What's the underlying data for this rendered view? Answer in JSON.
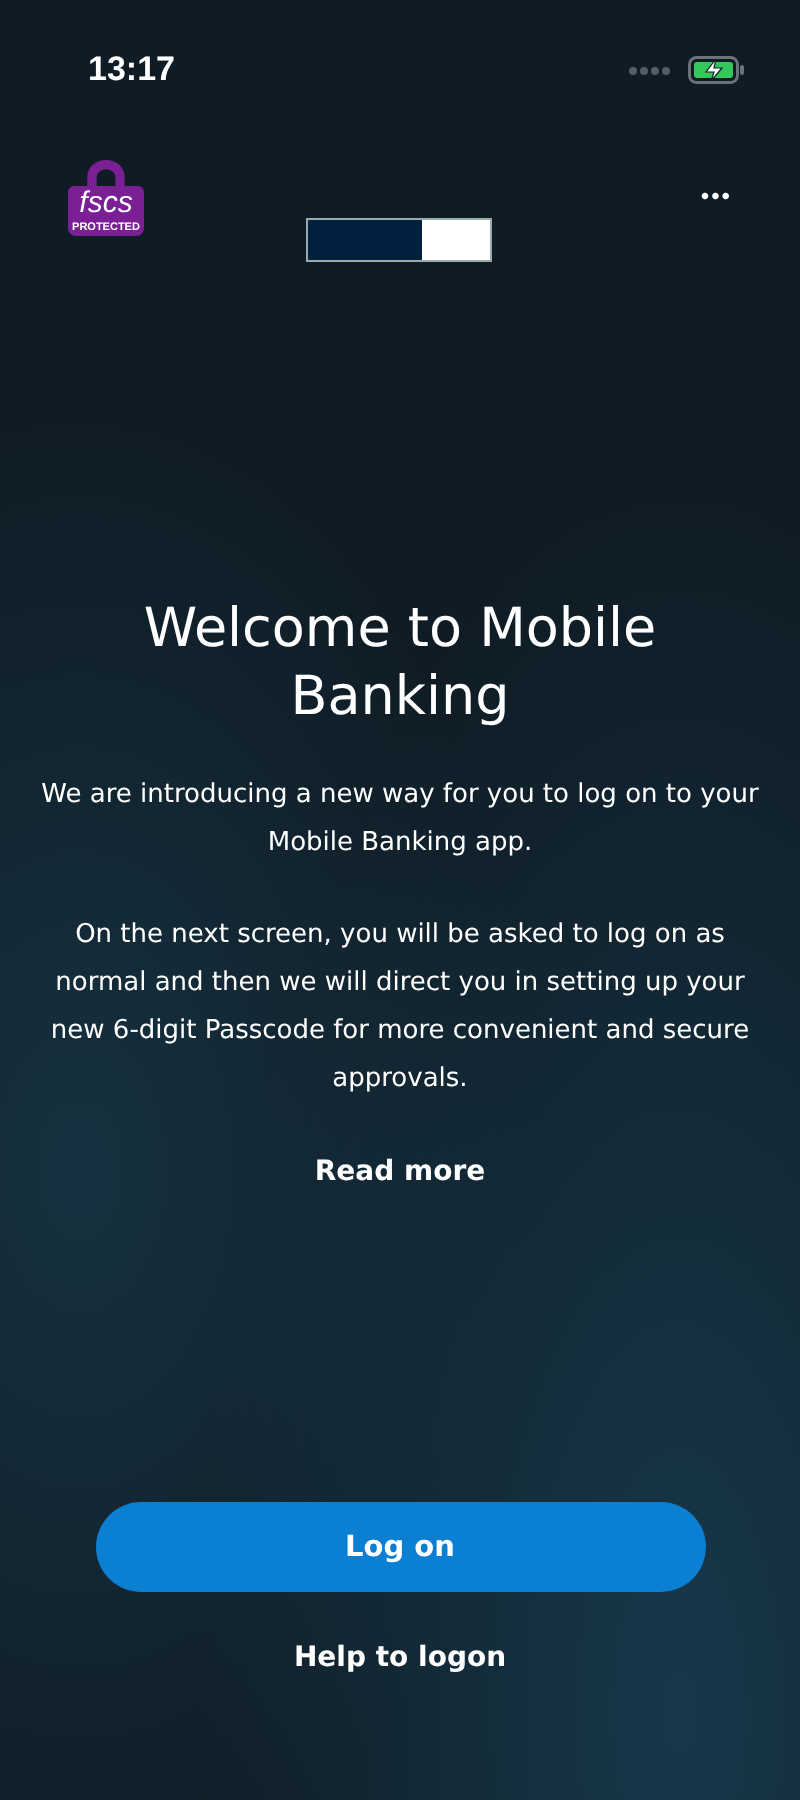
{
  "status_bar": {
    "time": "13:17"
  },
  "header": {
    "badge": {
      "mark": "fscs",
      "caption": "PROTECTED"
    },
    "menu": "•••"
  },
  "title": "Welcome to Mobile Banking",
  "paragraphs": [
    "We are introducing a new way for you to log on to your Mobile Banking app.",
    "On the next screen, you will be asked to log on as normal and then we will direct you in setting up your new 6-digit Passcode for more convenient and secure approvals."
  ],
  "read_more": "Read more",
  "primary_button": "Log on",
  "help_link": "Help to logon"
}
